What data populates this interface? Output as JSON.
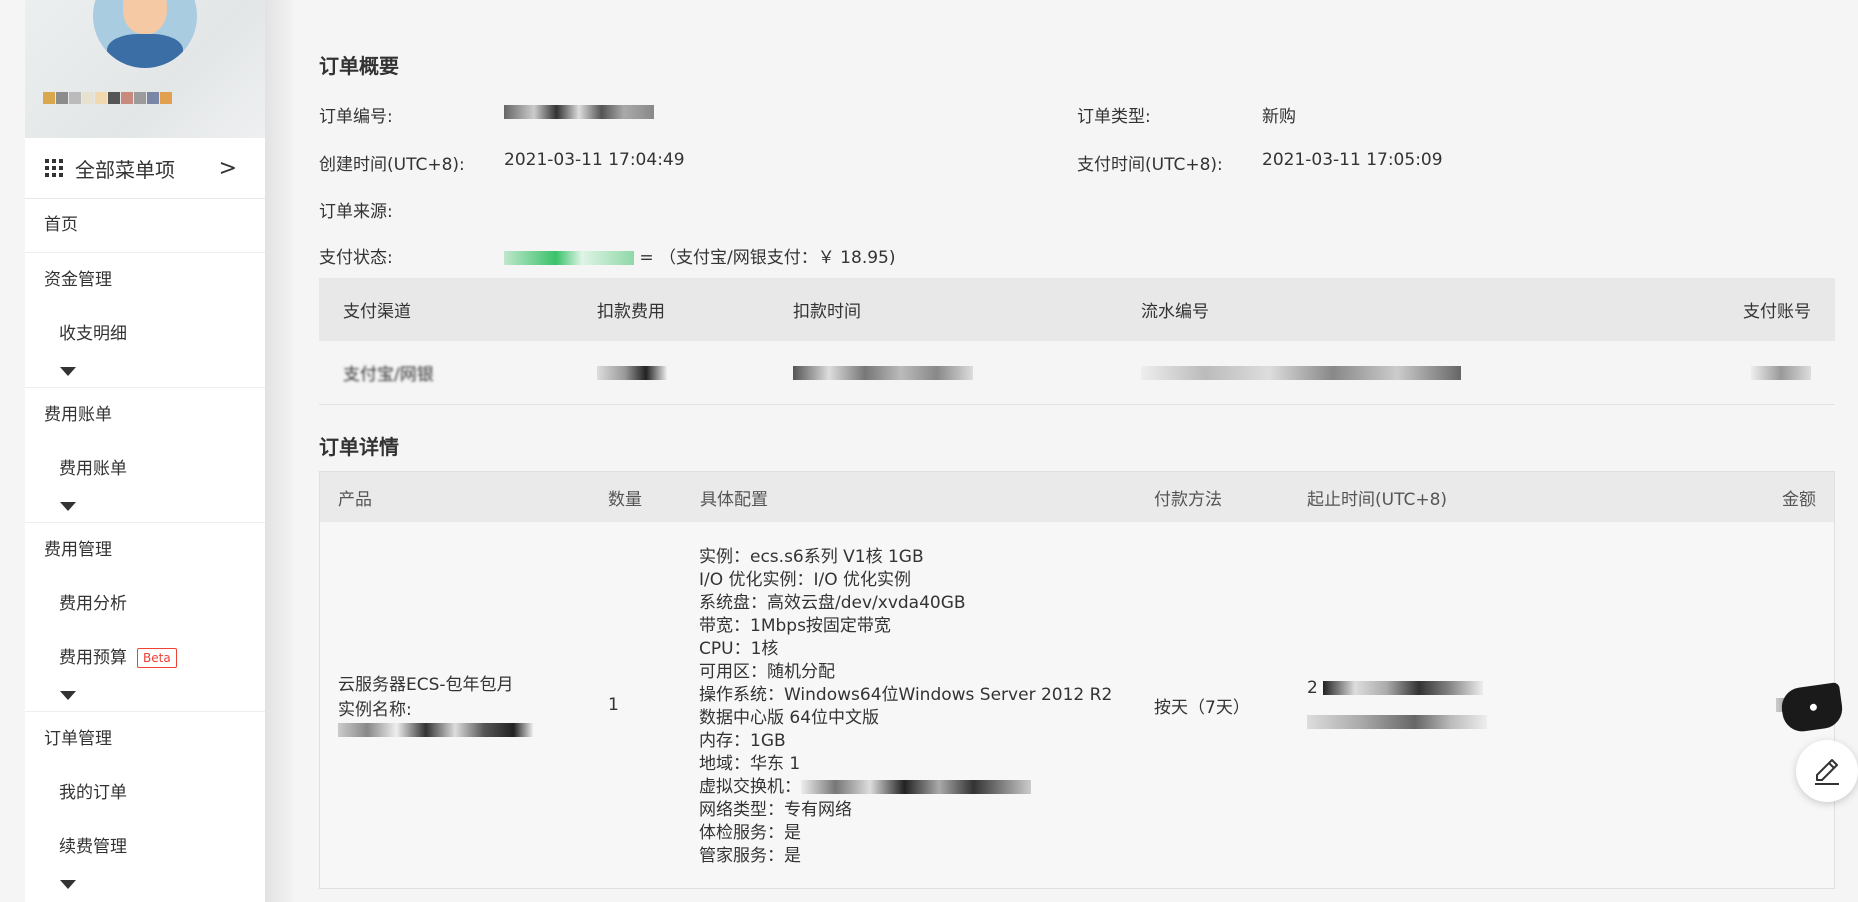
{
  "sidebar": {
    "menu_all": "全部菜单项",
    "home": "首页",
    "groups": [
      {
        "title": "资金管理",
        "items": [
          "收支明细"
        ]
      },
      {
        "title": "费用账单",
        "items": [
          "费用账单"
        ]
      },
      {
        "title": "费用管理",
        "items": [
          "费用分析",
          "费用预算"
        ]
      },
      {
        "title": "订单管理",
        "items": [
          "我的订单",
          "续费管理"
        ]
      }
    ],
    "beta_badge": "Beta"
  },
  "summary": {
    "title": "订单概要",
    "order_no_label": "订单编号:",
    "order_type_label": "订单类型:",
    "order_type_value": "新购",
    "created_label": "创建时间(UTC+8):",
    "created_value": "2021-03-11 17:04:49",
    "paid_label": "支付时间(UTC+8):",
    "paid_value": "2021-03-11 17:05:09",
    "source_label": "订单来源:",
    "status_label": "支付状态:",
    "status_suffix": "= （支付宝/网银支付：￥ 18.95)"
  },
  "payments": {
    "headers": [
      "支付渠道",
      "扣款费用",
      "扣款时间",
      "流水编号",
      "支付账号"
    ],
    "row": {
      "channel": "支付宝/网银"
    }
  },
  "detail": {
    "title": "订单详情",
    "headers": [
      "产品",
      "数量",
      "具体配置",
      "付款方法",
      "起止时间(UTC+8)",
      "金额"
    ],
    "product": "云服务器ECS-包年包月",
    "instance_label": "实例名称:",
    "quantity": "1",
    "config": [
      "实例：ecs.s6系列 V1核 1GB",
      "I/O 优化实例：I/O 优化实例",
      "系统盘：高效云盘/dev/xvda40GB",
      "带宽：1Mbps按固定带宽",
      "CPU：1核",
      "可用区：随机分配",
      "操作系统：Windows64位Windows Server 2012 R2",
      "数据中心版 64位中文版",
      "内存：1GB",
      "地域：华东 1",
      "虚拟交换机：",
      "网络类型：专有网络",
      "体检服务：是",
      "管家服务：是"
    ],
    "pay_method": "按天（7天）",
    "period_prefix": "2"
  }
}
